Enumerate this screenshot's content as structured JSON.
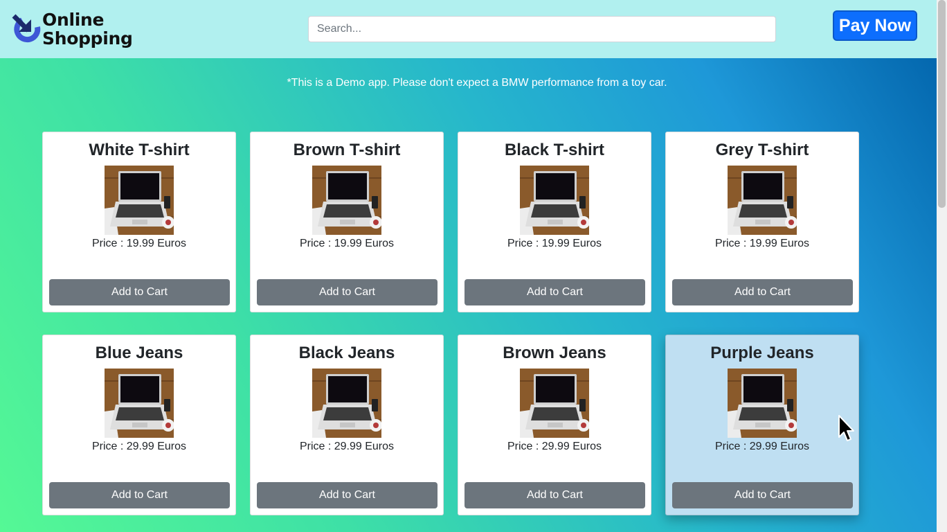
{
  "header": {
    "logo_line1": "Online",
    "logo_line2": "Shopping",
    "search_placeholder": "Search...",
    "pay_label": "Pay Now"
  },
  "notice": "*This is a Demo app. Please don't expect a BMW performance from a toy car.",
  "products": [
    {
      "title": "White T-shirt",
      "price": "Price : 19.99 Euros",
      "button": "Add to Cart"
    },
    {
      "title": "Brown T-shirt",
      "price": "Price : 19.99 Euros",
      "button": "Add to Cart"
    },
    {
      "title": "Black T-shirt",
      "price": "Price : 19.99 Euros",
      "button": "Add to Cart"
    },
    {
      "title": "Grey T-shirt",
      "price": "Price : 19.99 Euros",
      "button": "Add to Cart"
    },
    {
      "title": "Blue Jeans",
      "price": "Price : 29.99 Euros",
      "button": "Add to Cart"
    },
    {
      "title": "Black Jeans",
      "price": "Price : 29.99 Euros",
      "button": "Add to Cart"
    },
    {
      "title": "Brown Jeans",
      "price": "Price : 29.99 Euros",
      "button": "Add to Cart"
    },
    {
      "title": "Purple Jeans",
      "price": "Price : 29.99 Euros",
      "button": "Add to Cart"
    }
  ],
  "product_image": "laptop-photo",
  "colors": {
    "header_bg": "#b1f0ef",
    "pay_button": "#0d6efd",
    "cart_button": "#6c757d",
    "hover_card": "#bfdff2",
    "gradient_start": "#55f895",
    "gradient_end": "#0060a8"
  },
  "hovered_product": "Purple Jeans"
}
